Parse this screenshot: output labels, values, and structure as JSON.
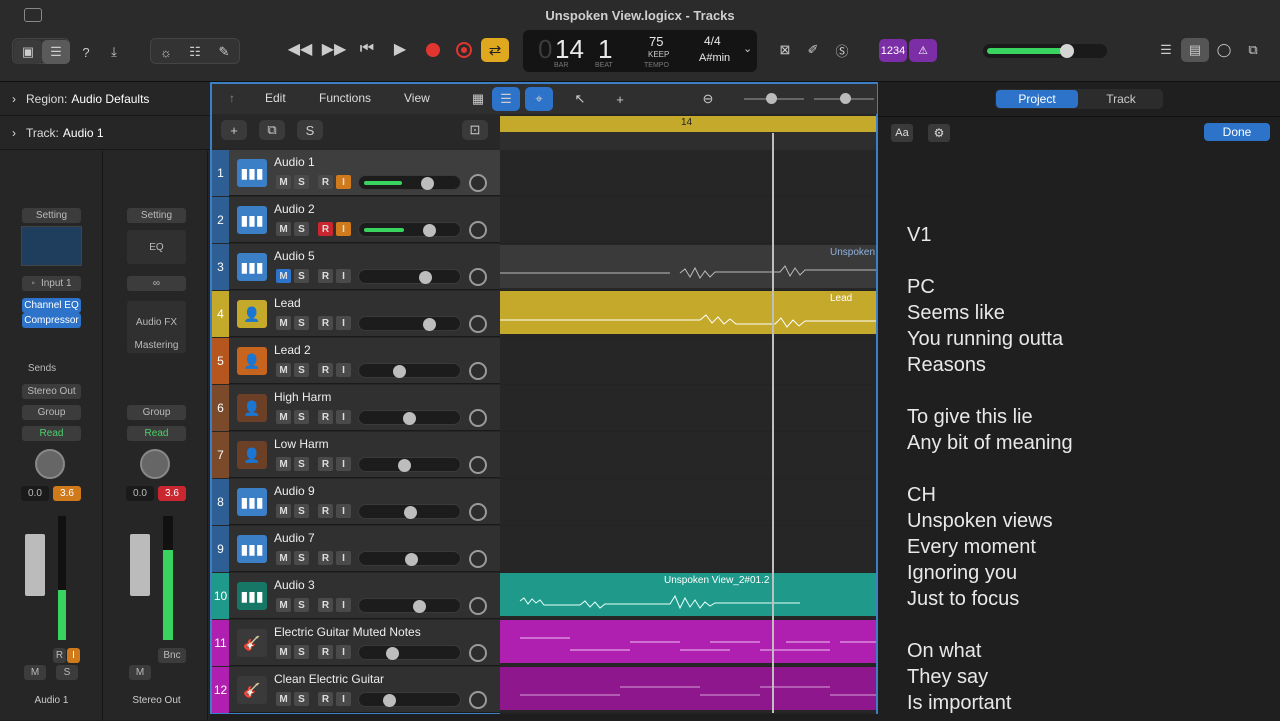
{
  "window": {
    "title": "Unspoken View.logicx - Tracks"
  },
  "lcd": {
    "bar": "14",
    "beat": "1",
    "bar_label": "BAR",
    "beat_label": "BEAT",
    "tempo": "75",
    "tempo_mode": "KEEP",
    "tempo_label": "TEMPO",
    "signature": "4/4",
    "key": "A#min",
    "bar_ghost": "0"
  },
  "purple_buttons": {
    "count_in": "1234"
  },
  "inspector": {
    "region_label": "Region:",
    "region_value": "Audio Defaults",
    "track_label": "Track:",
    "track_value": "Audio 1",
    "strip1": {
      "setting": "Setting",
      "input": "Input 1",
      "plugins": [
        "Channel EQ",
        "Compressor"
      ],
      "sends": "Sends",
      "output": "Stereo Out",
      "group": "Group",
      "automation": "Read",
      "vol": "0.0",
      "peak": "3.6",
      "mute": "M",
      "solo": "S",
      "rec": "R",
      "inmon": "I",
      "name": "Audio 1"
    },
    "strip2": {
      "setting": "Setting",
      "eq": "EQ",
      "audio_fx": "Audio FX",
      "mastering": "Mastering",
      "group": "Group",
      "automation": "Read",
      "vol": "0.0",
      "peak": "3.6",
      "bounce": "Bnc",
      "mute": "M",
      "name": "Stereo Out"
    }
  },
  "localmenu": {
    "edit": "Edit",
    "functions": "Functions",
    "view": "View"
  },
  "header_tools": {
    "add": "+",
    "solo": "S"
  },
  "ruler": {
    "bar_marker": "14"
  },
  "tracks": [
    {
      "num": "1",
      "name": "Audio 1"
    },
    {
      "num": "2",
      "name": "Audio 2"
    },
    {
      "num": "3",
      "name": "Audio 5"
    },
    {
      "num": "4",
      "name": "Lead"
    },
    {
      "num": "5",
      "name": "Lead 2"
    },
    {
      "num": "6",
      "name": "High Harm"
    },
    {
      "num": "7",
      "name": "Low Harm"
    },
    {
      "num": "8",
      "name": "Audio 9"
    },
    {
      "num": "9",
      "name": "Audio 7"
    },
    {
      "num": "10",
      "name": "Audio 3"
    },
    {
      "num": "11",
      "name": "Electric Guitar Muted Notes"
    },
    {
      "num": "12",
      "name": "Clean Electric Guitar"
    }
  ],
  "track_buttons": {
    "m": "M",
    "s": "S",
    "r": "R",
    "i": "I"
  },
  "regions": {
    "audio5": "Unspoken",
    "lead": "Lead",
    "audio3": "Unspoken View_2#01.2"
  },
  "right_panel": {
    "tab_project": "Project",
    "tab_track": "Track",
    "font_btn": "Aa",
    "done": "Done",
    "lyrics": [
      "V1",
      "PC",
      "Seems like",
      "You running outta",
      "Reasons",
      "To give this lie",
      "Any bit of meaning",
      "CH",
      "Unspoken views",
      "Every moment",
      "Ignoring you",
      "Just to focus",
      "On what",
      "They say",
      "Is important"
    ]
  },
  "colors": {
    "accent": "#3c7fc4",
    "lead": "#c4a92b",
    "audio3": "#1f9a8a",
    "guitar": "#b020b0",
    "rec": "#d33a3a",
    "volume": "#39d35f"
  }
}
